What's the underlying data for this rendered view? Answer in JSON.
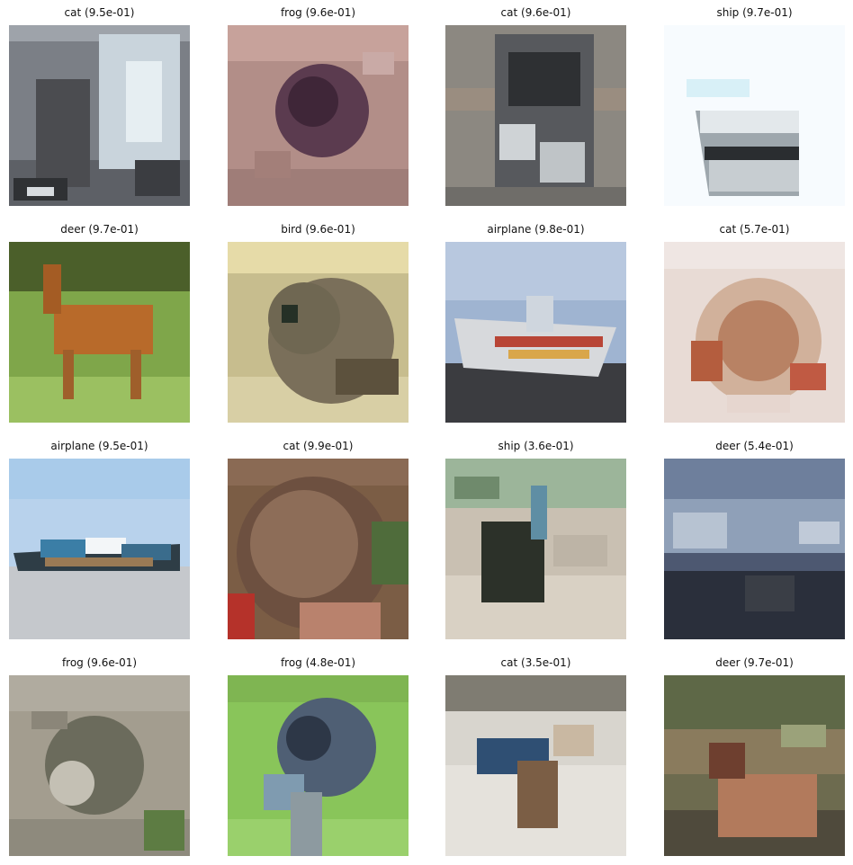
{
  "grid": {
    "items": [
      {
        "title": "cat (9.5e-01)"
      },
      {
        "title": "frog (9.6e-01)"
      },
      {
        "title": "cat (9.6e-01)"
      },
      {
        "title": "ship (9.7e-01)"
      },
      {
        "title": "deer (9.7e-01)"
      },
      {
        "title": "bird (9.6e-01)"
      },
      {
        "title": "airplane (9.8e-01)"
      },
      {
        "title": "cat (5.7e-01)"
      },
      {
        "title": "airplane (9.5e-01)"
      },
      {
        "title": "cat (9.9e-01)"
      },
      {
        "title": "ship (3.6e-01)"
      },
      {
        "title": "deer (5.4e-01)"
      },
      {
        "title": "frog (9.6e-01)"
      },
      {
        "title": "frog (4.8e-01)"
      },
      {
        "title": "cat (3.5e-01)"
      },
      {
        "title": "deer (9.7e-01)"
      }
    ]
  }
}
